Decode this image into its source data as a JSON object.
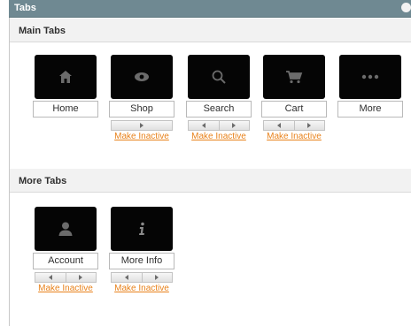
{
  "panel": {
    "title": "Tabs"
  },
  "main_tabs": {
    "title": "Main Tabs",
    "items": [
      {
        "label": "Home",
        "icon": "home-icon"
      },
      {
        "label": "Shop",
        "icon": "eye-icon",
        "action": "Make Inactive"
      },
      {
        "label": "Search",
        "icon": "search-icon",
        "action": "Make Inactive"
      },
      {
        "label": "Cart",
        "icon": "cart-icon",
        "action": "Make Inactive"
      },
      {
        "label": "More",
        "icon": "more-icon"
      }
    ]
  },
  "more_tabs": {
    "title": "More Tabs",
    "items": [
      {
        "label": "Account",
        "icon": "user-icon",
        "action": "Make Inactive"
      },
      {
        "label": "More Info",
        "icon": "info-icon",
        "action": "Make Inactive"
      }
    ]
  },
  "colors": {
    "header": "#6f8992",
    "tile": "#050505",
    "link": "#e8811a",
    "section": "#f2f2f2"
  }
}
